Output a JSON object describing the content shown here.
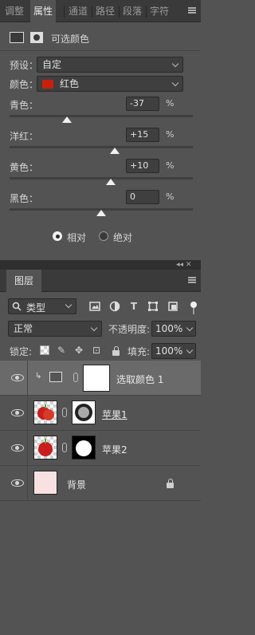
{
  "properties_panel": {
    "tabs": [
      {
        "label": "调整",
        "active": false
      },
      {
        "label": "属性",
        "active": true
      },
      {
        "label": "通道",
        "active": false
      },
      {
        "label": "路径",
        "active": false
      },
      {
        "label": "段落",
        "active": false
      },
      {
        "label": "字符",
        "active": false
      }
    ],
    "adjustment_title": "可选颜色",
    "preset_label": "预设：",
    "preset_value": "自定",
    "color_label": "颜色：",
    "color_value": "红色",
    "color_swatch": "#c8200e",
    "sliders": [
      {
        "label": "青色：",
        "value": "-37",
        "unit": "%",
        "level": -37
      },
      {
        "label": "洋红：",
        "value": "+15",
        "unit": "%",
        "level": 15
      },
      {
        "label": "黄色：",
        "value": "+10",
        "unit": "%",
        "level": 10
      },
      {
        "label": "黑色：",
        "value": "0",
        "unit": "%",
        "level": 0
      }
    ],
    "method_options": [
      {
        "label": "相对",
        "selected": true
      },
      {
        "label": "绝对",
        "selected": false
      }
    ]
  },
  "layers_panel": {
    "tab_label": "图层",
    "dock_controls": "◂◂ ✕",
    "filter_label": "类型",
    "filter_icons": [
      "image-filter-icon",
      "adjustment-filter-icon",
      "type-filter-icon",
      "shape-filter-icon",
      "smart-object-filter-icon"
    ],
    "blend_mode": "正常",
    "opacity_label": "不透明度:",
    "opacity_value": "100%",
    "lock_label": "锁定:",
    "fill_label": "填充:",
    "fill_value": "100%",
    "layers": [
      {
        "name": "选取颜色 1",
        "type": "adjustment",
        "selected": true
      },
      {
        "name": "苹果1",
        "type": "masked",
        "selected": false
      },
      {
        "name": "苹果2",
        "type": "masked",
        "selected": false
      },
      {
        "name": "背景",
        "type": "background",
        "selected": false,
        "locked": true,
        "color": "#f7e1e1"
      }
    ]
  }
}
